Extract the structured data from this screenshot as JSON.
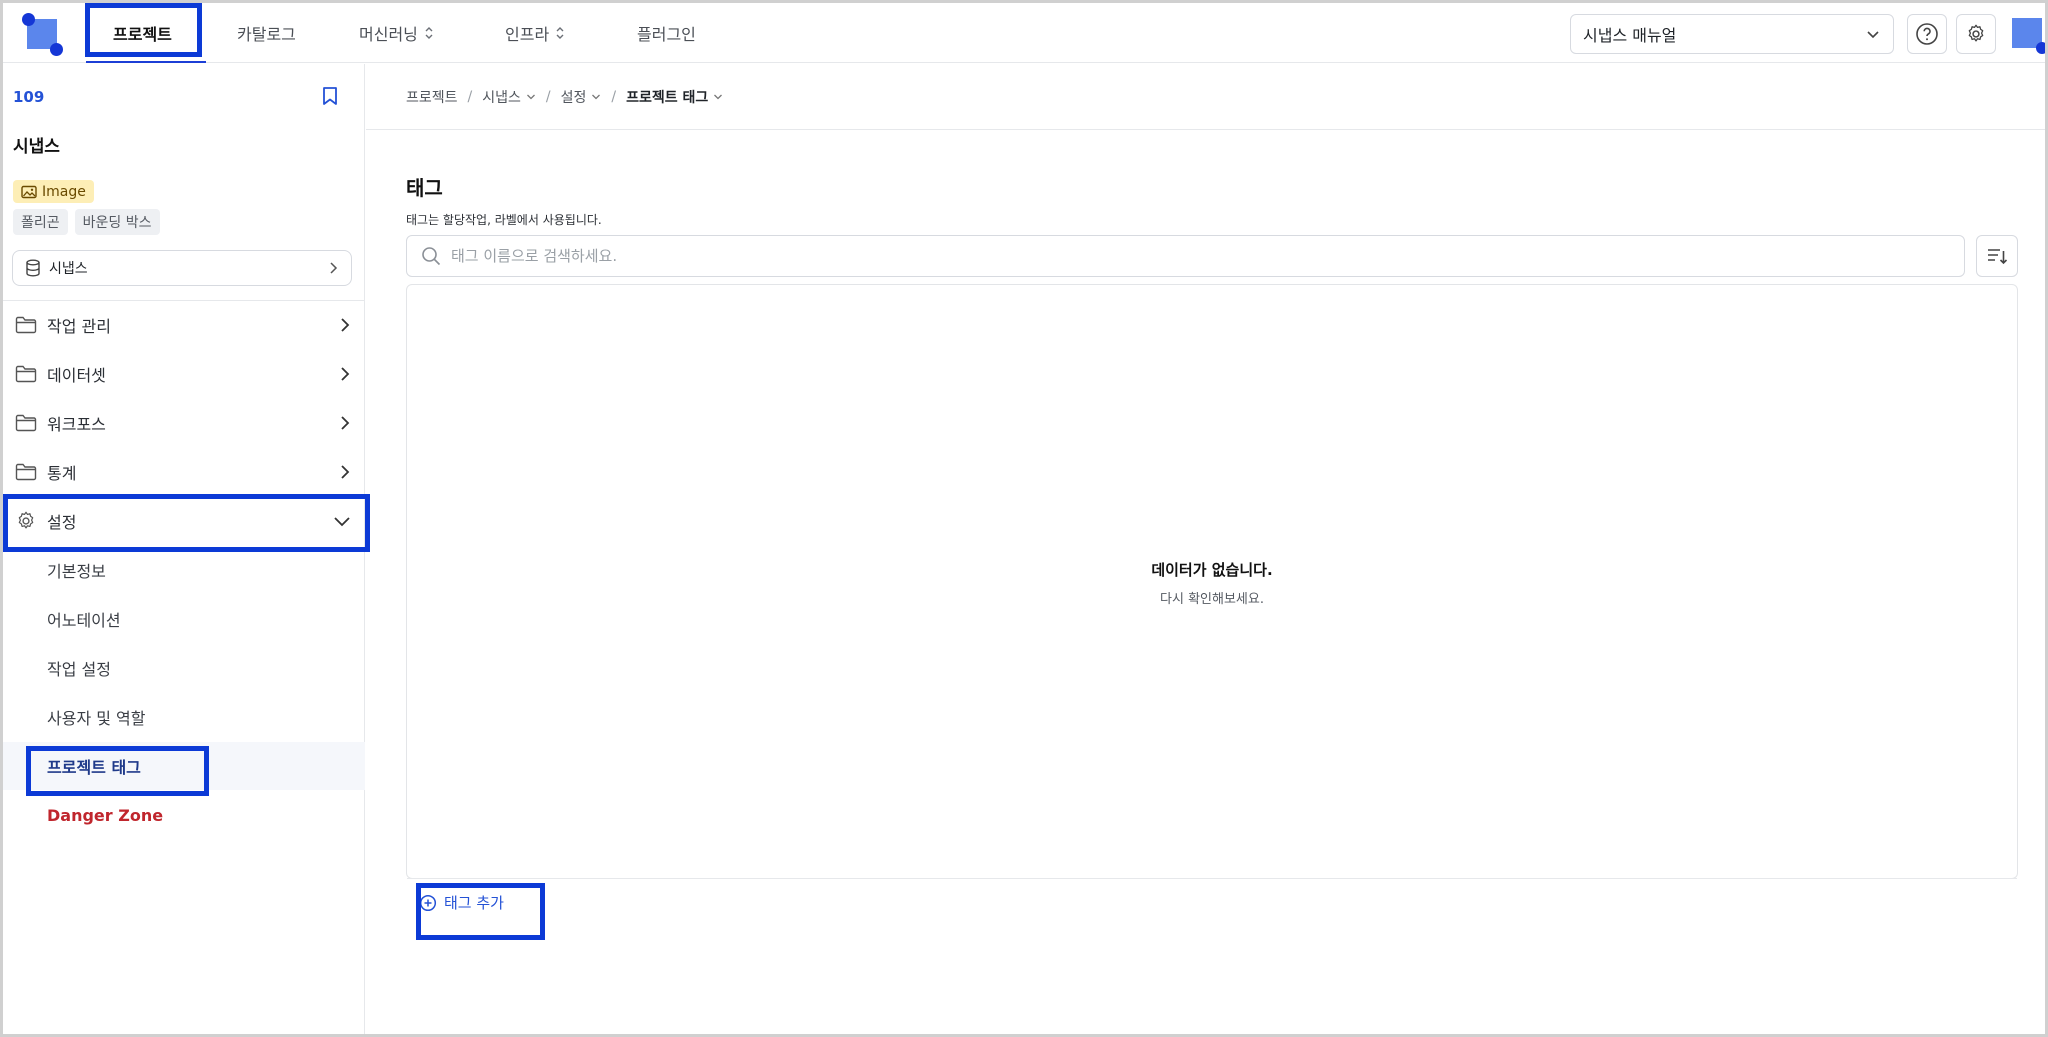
{
  "topnav": {
    "items": [
      {
        "label": "프로젝트",
        "has_chevron": false,
        "active": true
      },
      {
        "label": "카탈로그",
        "has_chevron": false,
        "active": false
      },
      {
        "label": "머신러닝",
        "has_chevron": true,
        "active": false
      },
      {
        "label": "인프라",
        "has_chevron": true,
        "active": false
      },
      {
        "label": "플러그인",
        "has_chevron": false,
        "active": false
      }
    ],
    "manual_select": "시냅스 매뉴얼"
  },
  "sidebar": {
    "project_id": "109",
    "project_name": "시냅스",
    "data_type_badge": "Image",
    "annotation_chips": [
      "폴리곤",
      "바운딩 박스"
    ],
    "dataset_select": "시냅스",
    "menu": [
      {
        "label": "작업 관리",
        "icon": "folder-icon",
        "expanded": false
      },
      {
        "label": "데이터셋",
        "icon": "folder-icon",
        "expanded": false
      },
      {
        "label": "워크포스",
        "icon": "folder-icon",
        "expanded": false
      },
      {
        "label": "통계",
        "icon": "folder-icon",
        "expanded": false
      },
      {
        "label": "설정",
        "icon": "gear-icon",
        "expanded": true
      }
    ],
    "settings_sub": [
      {
        "label": "기본정보"
      },
      {
        "label": "어노테이션"
      },
      {
        "label": "작업 설정"
      },
      {
        "label": "사용자 및 역할"
      },
      {
        "label": "프로젝트 태그"
      },
      {
        "label": "Danger Zone"
      }
    ]
  },
  "breadcrumb": [
    {
      "label": "프로젝트"
    },
    {
      "label": "시냅스"
    },
    {
      "label": "설정"
    },
    {
      "label": "프로젝트 태그"
    }
  ],
  "main": {
    "title": "태그",
    "description": "태그는 할당작업, 라벨에서 사용됩니다.",
    "search_placeholder": "태그 이름으로 검색하세요.",
    "empty_title": "데이터가 없습니다.",
    "empty_subtitle": "다시 확인해보세요.",
    "add_tag_label": "태그 추가"
  },
  "colors": {
    "accent": "#2452d6",
    "highlight": "#0c3ad6",
    "danger": "#c0262d",
    "badge_bg": "#fdeeb6"
  }
}
